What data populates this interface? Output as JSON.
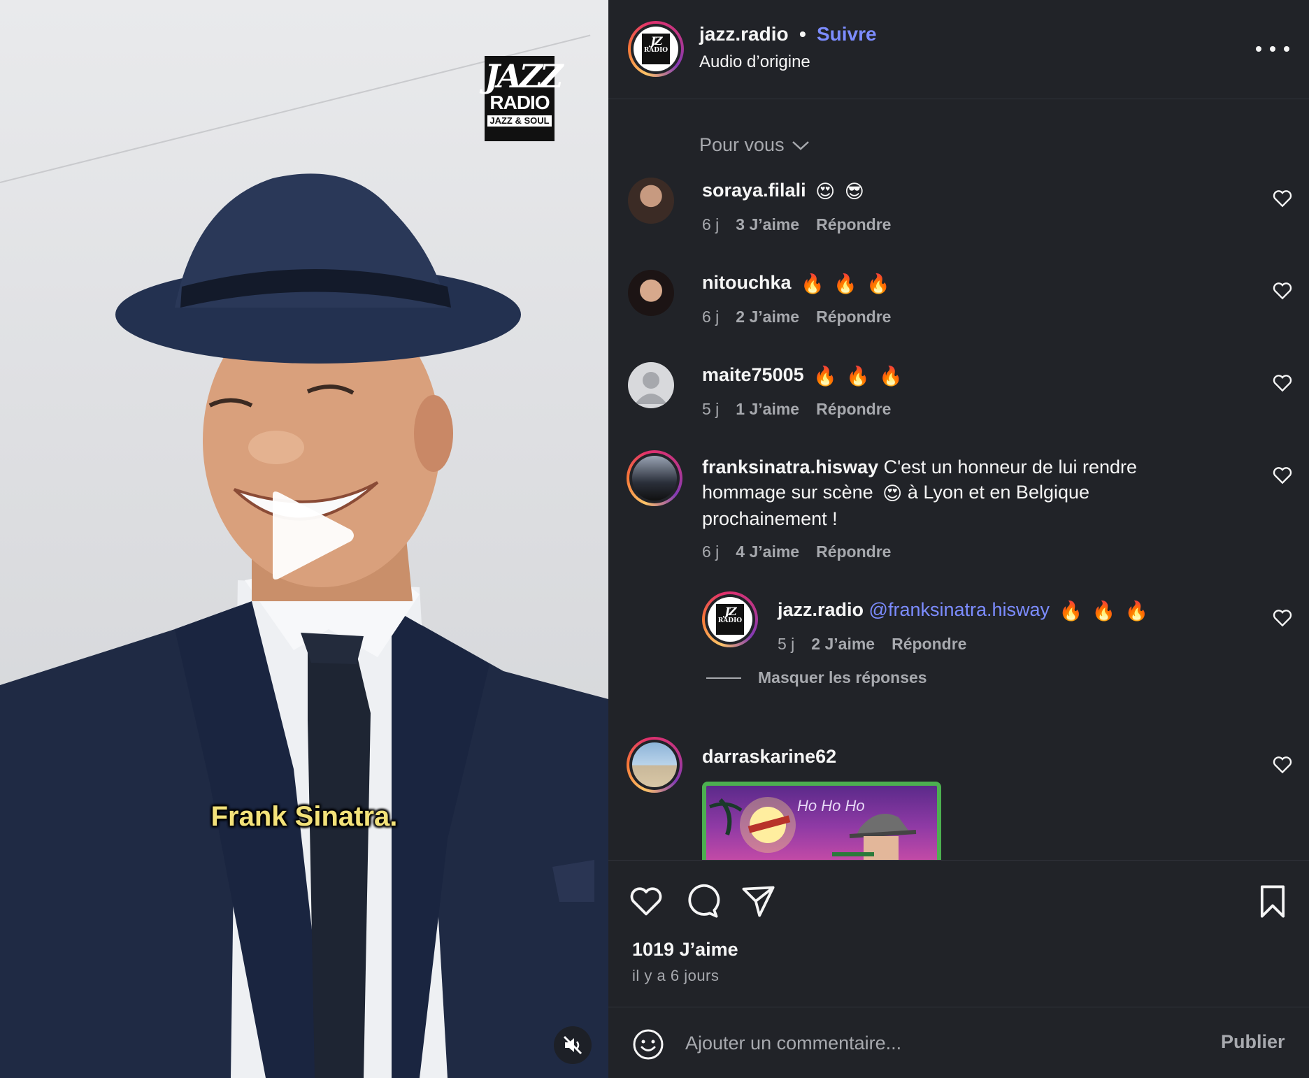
{
  "video": {
    "brand_logo": {
      "line1": "JAZZ",
      "line2": "RADIO",
      "line3": "JAZZ & SOUL"
    },
    "caption": "Frank Sinatra.",
    "play_icon": "play-icon",
    "mute_icon": "speaker-muted-icon"
  },
  "header": {
    "username": "jazz.radio",
    "separator": "•",
    "follow_label": "Suivre",
    "audio_label": "Audio d’origine",
    "more_icon": "more-horizontal-icon"
  },
  "sort": {
    "label": "Pour vous",
    "icon": "chevron-down-icon"
  },
  "comments": [
    {
      "user": "soraya.filali",
      "text": "",
      "emojis": [
        "😍",
        "😎"
      ],
      "time": "6 j",
      "likes": "3 J’aime",
      "reply": "Répondre"
    },
    {
      "user": "nitouchka",
      "text": "",
      "emojis": [
        "🔥",
        "🔥",
        "🔥"
      ],
      "time": "6 j",
      "likes": "2 J’aime",
      "reply": "Répondre"
    },
    {
      "user": "maite75005",
      "text": "",
      "emojis": [
        "🔥",
        "🔥",
        "🔥"
      ],
      "time": "5 j",
      "likes": "1 J’aime",
      "reply": "Répondre"
    },
    {
      "user": "franksinatra.hisway",
      "text_part1": "C'est un honneur de lui rendre hommage sur scène",
      "emoji_mid": "😍",
      "text_part2": "à Lyon et en Belgique prochainement !",
      "time": "6 j",
      "likes": "4 J’aime",
      "reply": "Répondre"
    },
    {
      "user": "jazz.radio",
      "mention": "@franksinatra.hisway",
      "emojis": [
        "🔥",
        "🔥",
        "🔥"
      ],
      "time": "5 j",
      "likes": "2 J’aime",
      "reply": "Répondre"
    },
    {
      "user": "darraskarine62"
    }
  ],
  "hide_replies_label": "Masquer les réponses",
  "gif_text": "Ho Ho Ho",
  "actions": {
    "like_icon": "heart-icon",
    "comment_icon": "comment-icon",
    "share_icon": "paper-plane-icon",
    "save_icon": "bookmark-icon",
    "likes_count": "1019 J’aime",
    "time_ago": "il y a 6 jours"
  },
  "composer": {
    "emoji_icon": "smiley-icon",
    "placeholder": "Ajouter un commentaire...",
    "publish_label": "Publier"
  },
  "colors": {
    "panel_bg": "#212328",
    "link_blue": "#7c8cff",
    "muted_text": "#a7a9ae"
  }
}
